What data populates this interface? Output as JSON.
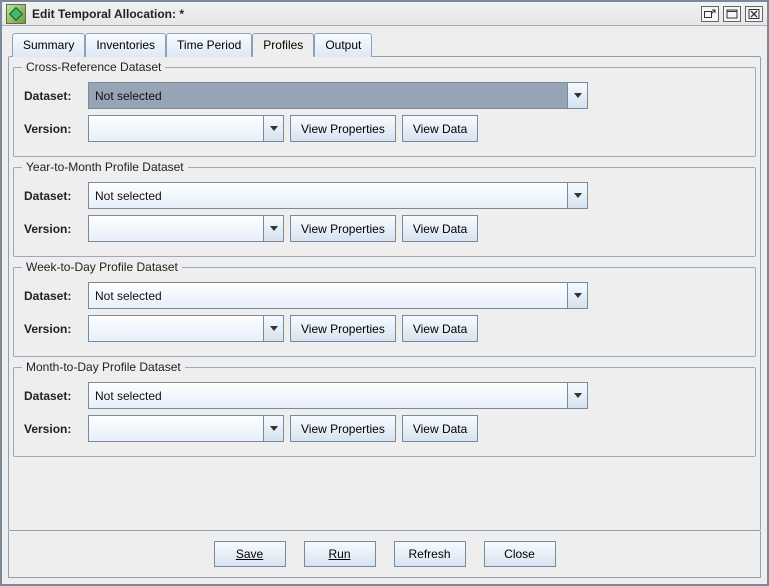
{
  "window": {
    "title": "Edit Temporal Allocation:  *"
  },
  "tabs": {
    "items": [
      {
        "label": "Summary"
      },
      {
        "label": "Inventories"
      },
      {
        "label": "Time Period"
      },
      {
        "label": "Profiles"
      },
      {
        "label": "Output"
      }
    ],
    "active_index": 3
  },
  "labels": {
    "dataset": "Dataset:",
    "version": "Version:",
    "view_properties": "View Properties",
    "view_data": "View Data"
  },
  "groups": [
    {
      "title": "Cross-Reference Dataset",
      "dataset_value": "Not selected",
      "dataset_highlighted": true,
      "version_value": ""
    },
    {
      "title": "Year-to-Month Profile Dataset",
      "dataset_value": "Not selected",
      "dataset_highlighted": false,
      "version_value": ""
    },
    {
      "title": "Week-to-Day Profile Dataset",
      "dataset_value": "Not selected",
      "dataset_highlighted": false,
      "version_value": ""
    },
    {
      "title": "Month-to-Day Profile Dataset",
      "dataset_value": "Not selected",
      "dataset_highlighted": false,
      "version_value": ""
    }
  ],
  "footer": {
    "save": "Save",
    "run": "Run",
    "refresh": "Refresh",
    "close": "Close"
  }
}
